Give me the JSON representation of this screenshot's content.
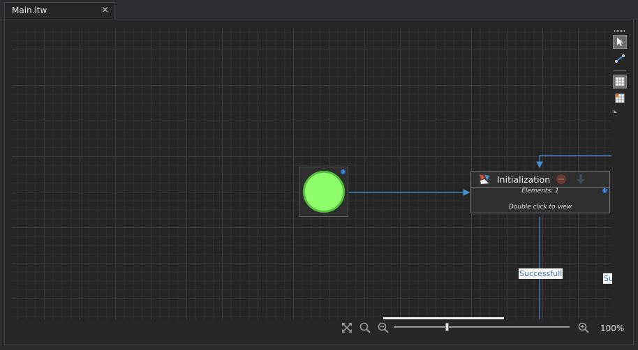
{
  "tab": {
    "title": "Main.ltw",
    "close_glyph": "×"
  },
  "toolbar": {
    "tools": [
      {
        "name": "pointer-tool-icon",
        "active": true
      },
      {
        "name": "connect-tool-icon",
        "active": false
      },
      {
        "name": "grid-toggle-icon",
        "active": true
      },
      {
        "name": "snap-grid-icon",
        "active": false
      }
    ]
  },
  "nodes": {
    "start": {
      "kind": "start",
      "info_glyph": "i"
    },
    "initialization": {
      "title": "Initialization",
      "elements_text": "Elements: 1",
      "hint_text": "Double click to view",
      "info_glyph": "i"
    }
  },
  "wire_labels": {
    "successful": "Successfull",
    "cut_off": "Su"
  },
  "zoom": {
    "level_text": "100%",
    "value": 0.3
  },
  "colors": {
    "start_fill": "#8eff6b",
    "start_border": "#58c03f",
    "wire": "#4a8fd0",
    "accent_blue": "#2a6fd6"
  }
}
